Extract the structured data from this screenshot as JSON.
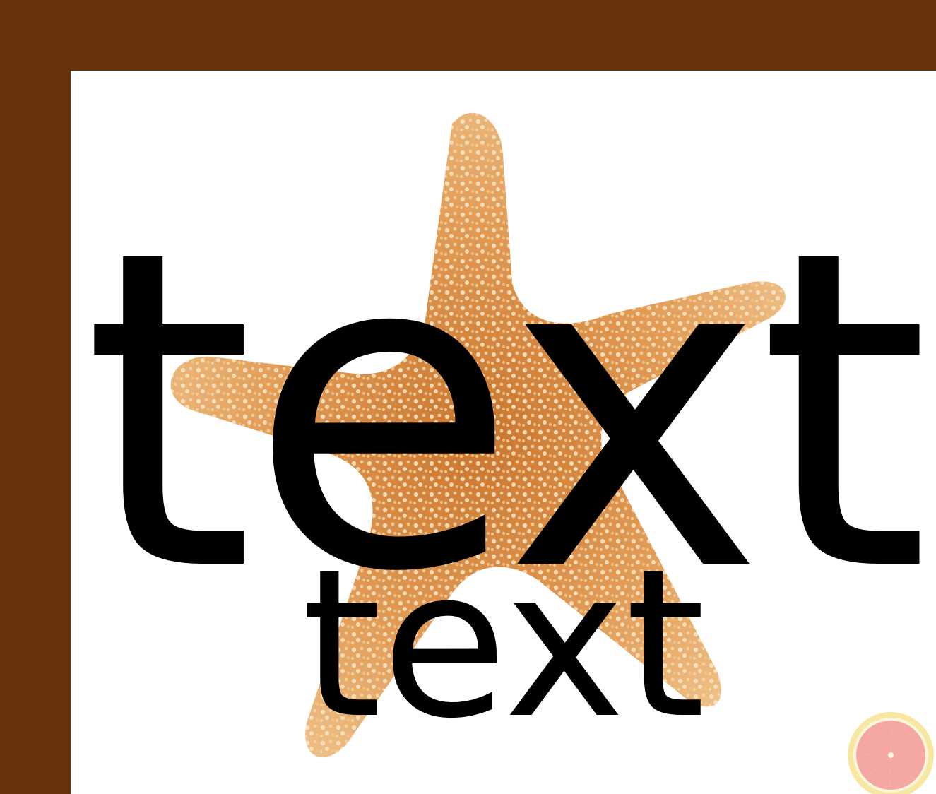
{
  "card": {
    "headline": "text",
    "subline": "text"
  },
  "colors": {
    "frame": "#66330d",
    "background": "#ffffff",
    "text": "#000000",
    "starfish_base": "#e39a52",
    "starfish_bumps": "#f6e3c2",
    "citrus_rind": "#f7e7a0",
    "citrus_flesh": "#f5a7a4"
  },
  "icons": {
    "starfish": "starfish-image",
    "logo": "grapefruit-slice-icon"
  }
}
